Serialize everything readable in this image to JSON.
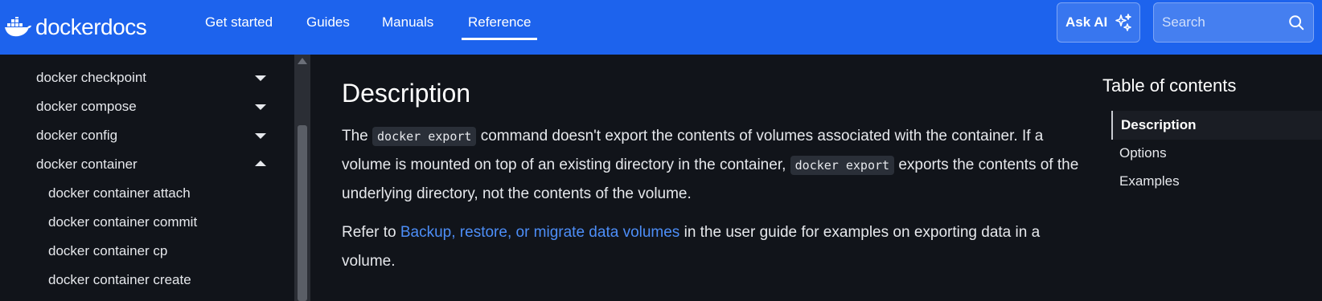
{
  "brand": {
    "name_bold": "docker",
    "name_light": "docs"
  },
  "nav": [
    "Get started",
    "Guides",
    "Manuals",
    "Reference"
  ],
  "nav_active": "Reference",
  "ask_ai": {
    "label": "Ask AI"
  },
  "search": {
    "placeholder": "Search"
  },
  "sidebar": {
    "items": [
      {
        "label": "docker checkpoint",
        "expanded": false
      },
      {
        "label": "docker compose",
        "expanded": false
      },
      {
        "label": "docker config",
        "expanded": false
      },
      {
        "label": "docker container",
        "expanded": true
      },
      {
        "label": "docker container attach"
      },
      {
        "label": "docker container commit"
      },
      {
        "label": "docker container cp"
      },
      {
        "label": "docker container create"
      }
    ]
  },
  "content": {
    "heading": "Description",
    "para1": {
      "t1": "The ",
      "code1": "docker export",
      "t2": " command doesn't export the contents of volumes associated with the container. If a volume is mounted on top of an existing directory in the container, ",
      "code2": "docker export",
      "t3": " exports the contents of the underlying directory, not the contents of the volume."
    },
    "para2": {
      "t1": "Refer to ",
      "link": "Backup, restore, or migrate data volumes",
      "t2": " in the user guide for examples on exporting data in a volume."
    }
  },
  "toc": {
    "title": "Table of contents",
    "items": [
      "Description",
      "Options",
      "Examples"
    ],
    "active": "Description"
  },
  "colors": {
    "topbar": "#1d63ed",
    "background": "#11141a",
    "link": "#4d8ef8",
    "code_bg": "#2a2f38"
  },
  "icons": [
    "docker-whale-icon",
    "sparkles-icon",
    "search-icon",
    "caret-down-icon",
    "caret-up-icon"
  ]
}
